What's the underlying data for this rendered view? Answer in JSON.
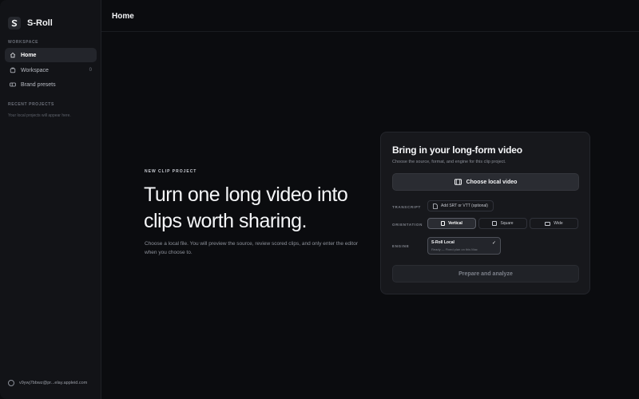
{
  "app": {
    "name": "S-Roll",
    "logo_letter": "S"
  },
  "sidebar": {
    "workspace_label": "WORKSPACE",
    "items": [
      {
        "label": "Home",
        "icon": "home-icon",
        "active": true
      },
      {
        "label": "Workspace",
        "icon": "folder-icon",
        "count": "0"
      },
      {
        "label": "Brand presets",
        "icon": "presets-icon"
      }
    ],
    "recent_label": "RECENT PROJECTS",
    "recent_empty": "Your local projects will appear here.",
    "user_email": "v9ywj7bbwz@pr...elay.appleid.com"
  },
  "header": {
    "title": "Home"
  },
  "hero": {
    "eyebrow": "NEW CLIP PROJECT",
    "title": "Turn one long video into clips worth sharing.",
    "description": "Choose a local file. You will preview the source, review scored clips, and only enter the editor when you choose to."
  },
  "card": {
    "title": "Bring in your long-form video",
    "subtitle": "Choose the source, format, and engine for this clip project.",
    "choose_button": "Choose local video",
    "transcript_label": "TRANSCRIPT",
    "transcript_button": "Add SRT or VTT (optional)",
    "orientation_label": "ORIENTATION",
    "orientations": [
      {
        "label": "Vertical",
        "selected": true
      },
      {
        "label": "Square",
        "selected": false
      },
      {
        "label": "Wide",
        "selected": false
      }
    ],
    "engine_label": "ENGINE",
    "engine": {
      "name": "S-Roll Local",
      "status": "Ready — Fixed plan on this Mac",
      "selected": true
    },
    "analyze_button": "Prepare and analyze"
  },
  "colors": {
    "background": "#0b0c0f",
    "sidebar": "#121317",
    "card": "#17181c",
    "text_primary": "#f3f4f6",
    "text_muted": "#8a8e97"
  }
}
